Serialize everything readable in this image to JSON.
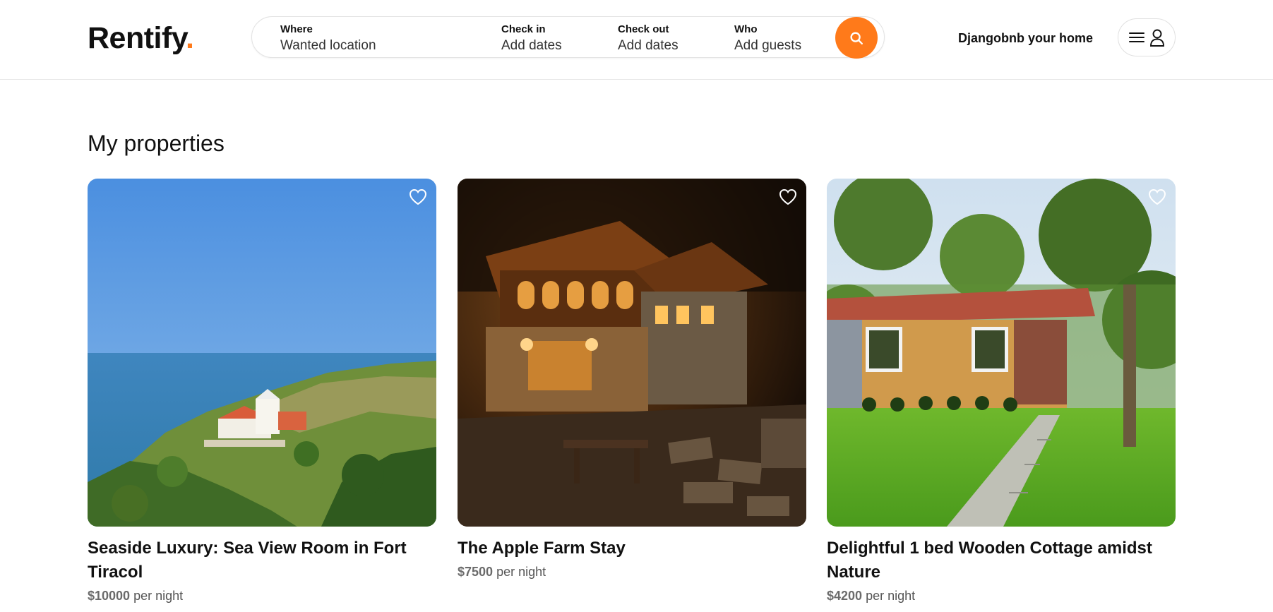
{
  "brand": {
    "name": "Rentify",
    "dot": ".",
    "accent": "#ff7a1a"
  },
  "search": {
    "where": {
      "label": "Where",
      "value": "Wanted location"
    },
    "check_in": {
      "label": "Check in",
      "value": "Add dates"
    },
    "check_out": {
      "label": "Check out",
      "value": "Add dates"
    },
    "who": {
      "label": "Who",
      "value": "Add guests"
    },
    "button_icon": "search-icon"
  },
  "header": {
    "host_link": "Djangobnb your home",
    "menu_icons": [
      "hamburger-menu-icon",
      "user-icon"
    ]
  },
  "main": {
    "title": "My properties",
    "properties": [
      {
        "title": "Seaside Luxury: Sea View Room in Fort Tiracol",
        "price": "$10000",
        "per": "per night",
        "image": "sea-view-fort-photo",
        "favorite_icon": "heart-icon"
      },
      {
        "title": "The Apple Farm Stay",
        "price": "$7500",
        "per": "per night",
        "image": "stone-wood-farmhouse-night-photo",
        "favorite_icon": "heart-icon"
      },
      {
        "title": "Delightful 1 bed Wooden Cottage amidst Nature",
        "price": "$4200",
        "per": "per night",
        "image": "wooden-cottage-garden-photo",
        "favorite_icon": "heart-icon"
      }
    ]
  }
}
